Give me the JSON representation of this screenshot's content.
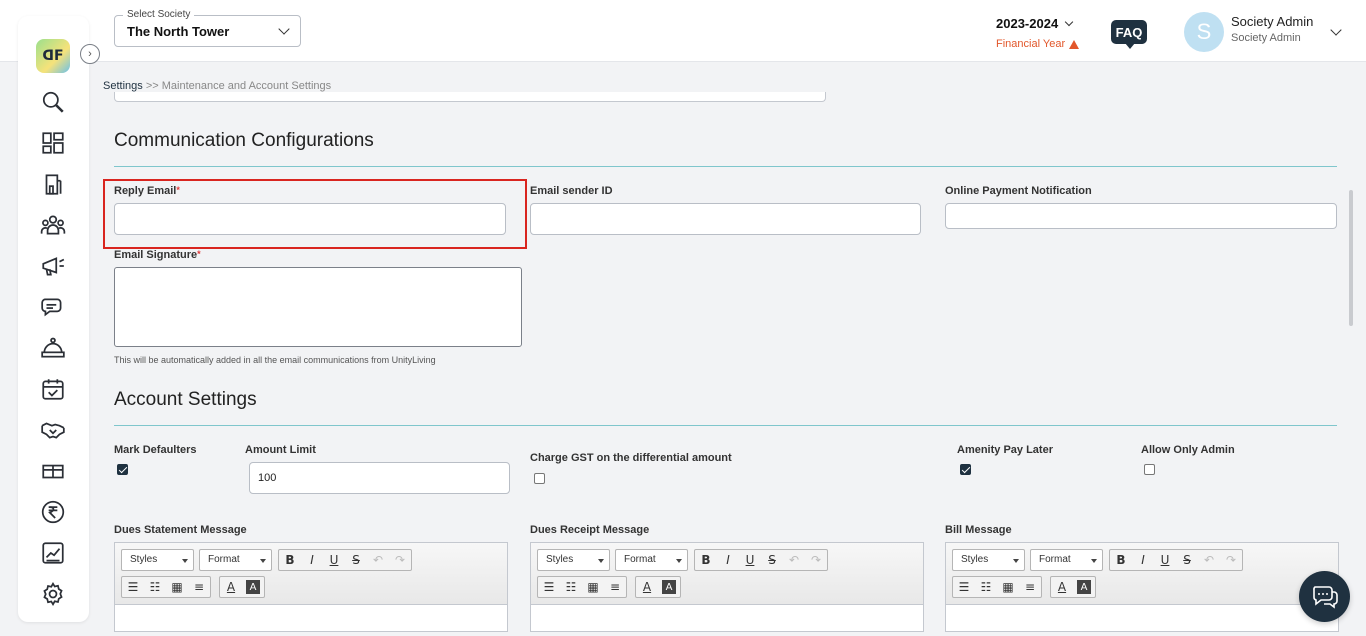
{
  "header": {
    "society_label": "Select Society",
    "society_value": "The North Tower",
    "year": "2023-2024",
    "financial_year_label": "Financial Year",
    "faq": "FAQ",
    "avatar_letter": "S",
    "user_name": "Society Admin",
    "user_role": "Society Admin"
  },
  "sidebar": {
    "logo_text": "ᗡF",
    "icons": [
      "search-icon",
      "dashboard-icon",
      "building-icon",
      "members-icon",
      "announcement-icon",
      "chat-icon",
      "helpdesk-bell-icon",
      "calendar-icon",
      "handshake-icon",
      "gift-icon",
      "rupee-icon",
      "reports-icon",
      "settings-icon"
    ]
  },
  "breadcrumb": {
    "root": "Settings",
    "separator": ">>",
    "current": "Maintenance and Account Settings"
  },
  "communication": {
    "title": "Communication Configurations",
    "reply_email_label": "Reply Email",
    "reply_email_value": "",
    "sender_id_label": "Email sender ID",
    "sender_id_value": "",
    "payment_notification_label": "Online Payment Notification",
    "payment_notification_value": "",
    "signature_label": "Email Signature",
    "signature_helper": "This will be automatically added in all the email communications from UnityLiving",
    "required_mark": "*"
  },
  "account": {
    "title": "Account Settings",
    "mark_defaulters_label": "Mark Defaulters",
    "mark_defaulters_checked": true,
    "amount_limit_label": "Amount Limit",
    "amount_limit_value": "100",
    "gst_label": "Charge GST on the differential amount",
    "gst_checked": false,
    "amenity_label": "Amenity Pay Later",
    "amenity_checked": true,
    "admin_only_label": "Allow Only Admin",
    "admin_only_checked": false
  },
  "editors": [
    {
      "label": "Dues Statement Message",
      "styles": "Styles",
      "format": "Format"
    },
    {
      "label": "Dues Receipt Message",
      "styles": "Styles",
      "format": "Format"
    },
    {
      "label": "Bill Message",
      "styles": "Styles",
      "format": "Format"
    }
  ],
  "toolbar_glyphs": {
    "bold": "B",
    "italic": "I",
    "underline": "U",
    "strike": "S",
    "undo": "↶",
    "redo": "↷",
    "text_color": "A",
    "bg_color": "A"
  },
  "colors": {
    "accent": "#1f3140",
    "warning": "#e2572b",
    "highlight": "#d9251f",
    "divider": "#7fc6cc"
  }
}
